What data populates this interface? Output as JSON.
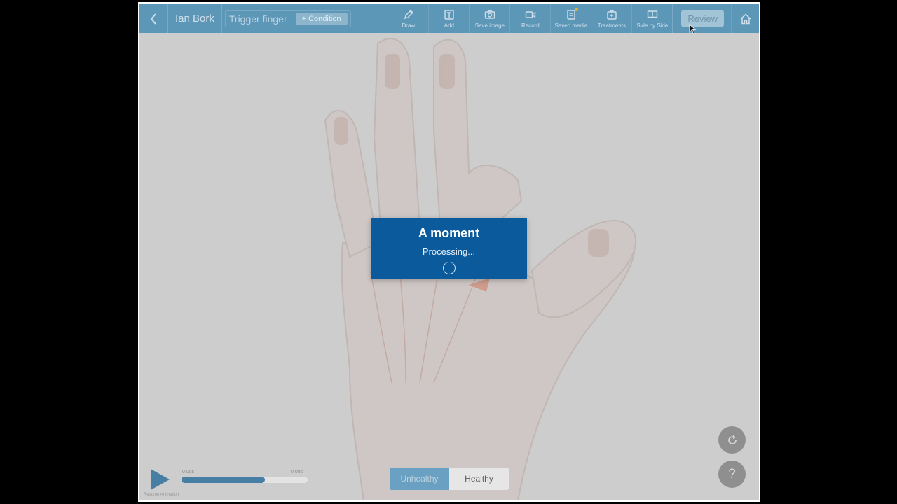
{
  "toolbar": {
    "patient_name": "Ian Bork",
    "condition_name": "Trigger finger",
    "add_condition_label": "+ Condition",
    "tools": [
      {
        "label": "Draw",
        "icon": "pencil-icon"
      },
      {
        "label": "Add",
        "icon": "text-box-icon"
      },
      {
        "label": "Save image",
        "icon": "camera-icon"
      },
      {
        "label": "Record",
        "icon": "video-camera-icon"
      },
      {
        "label": "Saved media",
        "icon": "document-icon"
      },
      {
        "label": "Treatments",
        "icon": "medical-kit-icon"
      },
      {
        "label": "Side by Side",
        "icon": "open-book-icon"
      }
    ],
    "review_label": "Review",
    "home_icon": "home-icon"
  },
  "modal": {
    "title": "A moment",
    "subtitle": "Processing..."
  },
  "player": {
    "caption": "Resume Animation",
    "time_start": "0.05s",
    "time_end": "0.08s",
    "progress": 0.66
  },
  "toggle": {
    "options": [
      "Unhealthy",
      "Healthy"
    ],
    "selected": "Healthy"
  },
  "colors": {
    "toolbar": "#5d97b8",
    "modal": "#0a5a9c",
    "accent": "#477ea3"
  }
}
